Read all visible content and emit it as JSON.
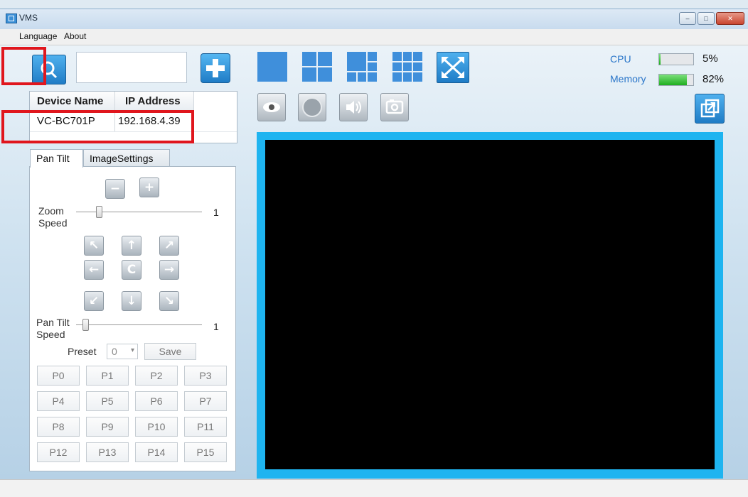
{
  "window": {
    "title": "VMS",
    "minimize": "–",
    "maximize": "□",
    "close": "✕"
  },
  "menu": [
    "Language",
    "About"
  ],
  "device_search": {
    "value": ""
  },
  "device_table": {
    "columns": [
      "Device Name",
      "IP Address"
    ],
    "rows": [
      {
        "name": "VC-BC701P",
        "ip": "192.168.4.39"
      }
    ]
  },
  "tabs": [
    "Pan Tilt",
    "ImageSettings"
  ],
  "pan_tilt": {
    "zoom_label": "Zoom\nSpeed",
    "zoom_value": "1",
    "pan_tilt_label": "Pan Tilt\nSpeed",
    "pan_tilt_value": "1",
    "zoom_speed_level": 1,
    "pan_tilt_speed_level": 1,
    "preset_label": "Preset",
    "preset_value": "0",
    "save_label": "Save",
    "presets": [
      "P0",
      "P1",
      "P2",
      "P3",
      "P4",
      "P5",
      "P6",
      "P7",
      "P8",
      "P9",
      "P10",
      "P11",
      "P12",
      "P13",
      "P14",
      "P15"
    ],
    "arrows": {
      "up_left": "↖",
      "up": "↑",
      "up_right": "↗",
      "left": "←",
      "home": "C",
      "right": "→",
      "down_left": "↙",
      "down": "↓",
      "down_right": "↘"
    },
    "zoom_out": "−",
    "zoom_in": "+"
  },
  "status": {
    "cpu_label": "CPU",
    "cpu_value": "5%",
    "cpu_fraction": 0.05,
    "memory_label": "Memory",
    "memory_value": "82%",
    "memory_fraction": 0.82
  },
  "colors": {
    "accent": "#1f7cc6",
    "video_border": "#1eb4f0",
    "highlight": "#e0161d",
    "memory_bar": "#1fae1f"
  }
}
